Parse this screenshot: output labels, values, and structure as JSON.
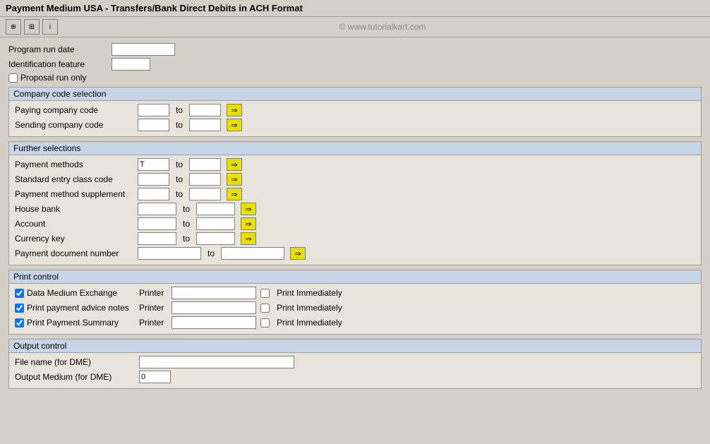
{
  "title": "Payment Medium USA - Transfers/Bank Direct Debits in ACH Format",
  "copyright": "© www.tutorialkart.com",
  "toolbar": {
    "btn1": "⊕",
    "btn2": "⊞",
    "btn3": "ℹ"
  },
  "top_fields": {
    "program_run_date_label": "Program run date",
    "identification_feature_label": "Identification feature",
    "proposal_run_only_label": "Proposal run only"
  },
  "company_code_section": {
    "header": "Company code selection",
    "paying_company_code_label": "Paying company code",
    "sending_company_code_label": "Sending company code",
    "to": "to"
  },
  "further_selections_section": {
    "header": "Further selections",
    "fields": [
      {
        "label": "Payment methods",
        "from_value": "T",
        "from_width": "sm"
      },
      {
        "label": "Standard entry class code",
        "from_value": "",
        "from_width": "sm"
      },
      {
        "label": "Payment method supplement",
        "from_value": "",
        "from_width": "sm"
      },
      {
        "label": "House bank",
        "from_value": "",
        "from_width": "md"
      },
      {
        "label": "Account",
        "from_value": "",
        "from_width": "md"
      },
      {
        "label": "Currency key",
        "from_value": "",
        "from_width": "md"
      },
      {
        "label": "Payment document number",
        "from_value": "",
        "from_width": "lg"
      }
    ],
    "to": "to"
  },
  "print_control_section": {
    "header": "Print control",
    "fields": [
      {
        "label": "Data Medium Exchange",
        "checked": true,
        "printer_value": "",
        "print_immediately_checked": false
      },
      {
        "label": "Print payment advice notes",
        "checked": true,
        "printer_value": "",
        "print_immediately_checked": false
      },
      {
        "label": "Print Payment Summary",
        "checked": true,
        "printer_value": "",
        "print_immediately_checked": false
      }
    ],
    "printer_label": "Printer",
    "print_immediately_label": "Print Immediately"
  },
  "output_control_section": {
    "header": "Output control",
    "file_name_label": "File name (for DME)",
    "output_medium_label": "Output Medium (for DME)",
    "output_medium_value": "0"
  }
}
